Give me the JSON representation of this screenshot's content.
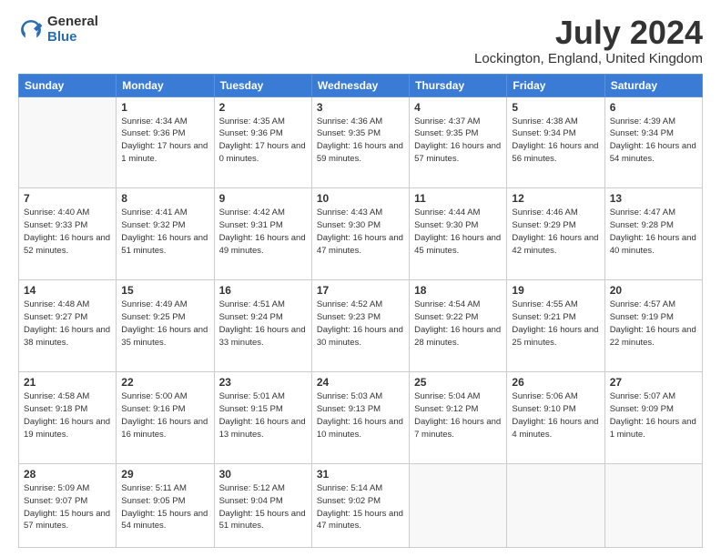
{
  "logo": {
    "general": "General",
    "blue": "Blue"
  },
  "title": "July 2024",
  "subtitle": "Lockington, England, United Kingdom",
  "days_of_week": [
    "Sunday",
    "Monday",
    "Tuesday",
    "Wednesday",
    "Thursday",
    "Friday",
    "Saturday"
  ],
  "weeks": [
    [
      {
        "day": "",
        "info": ""
      },
      {
        "day": "1",
        "info": "Sunrise: 4:34 AM\nSunset: 9:36 PM\nDaylight: 17 hours\nand 1 minute."
      },
      {
        "day": "2",
        "info": "Sunrise: 4:35 AM\nSunset: 9:36 PM\nDaylight: 17 hours\nand 0 minutes."
      },
      {
        "day": "3",
        "info": "Sunrise: 4:36 AM\nSunset: 9:35 PM\nDaylight: 16 hours\nand 59 minutes."
      },
      {
        "day": "4",
        "info": "Sunrise: 4:37 AM\nSunset: 9:35 PM\nDaylight: 16 hours\nand 57 minutes."
      },
      {
        "day": "5",
        "info": "Sunrise: 4:38 AM\nSunset: 9:34 PM\nDaylight: 16 hours\nand 56 minutes."
      },
      {
        "day": "6",
        "info": "Sunrise: 4:39 AM\nSunset: 9:34 PM\nDaylight: 16 hours\nand 54 minutes."
      }
    ],
    [
      {
        "day": "7",
        "info": "Sunrise: 4:40 AM\nSunset: 9:33 PM\nDaylight: 16 hours\nand 52 minutes."
      },
      {
        "day": "8",
        "info": "Sunrise: 4:41 AM\nSunset: 9:32 PM\nDaylight: 16 hours\nand 51 minutes."
      },
      {
        "day": "9",
        "info": "Sunrise: 4:42 AM\nSunset: 9:31 PM\nDaylight: 16 hours\nand 49 minutes."
      },
      {
        "day": "10",
        "info": "Sunrise: 4:43 AM\nSunset: 9:30 PM\nDaylight: 16 hours\nand 47 minutes."
      },
      {
        "day": "11",
        "info": "Sunrise: 4:44 AM\nSunset: 9:30 PM\nDaylight: 16 hours\nand 45 minutes."
      },
      {
        "day": "12",
        "info": "Sunrise: 4:46 AM\nSunset: 9:29 PM\nDaylight: 16 hours\nand 42 minutes."
      },
      {
        "day": "13",
        "info": "Sunrise: 4:47 AM\nSunset: 9:28 PM\nDaylight: 16 hours\nand 40 minutes."
      }
    ],
    [
      {
        "day": "14",
        "info": "Sunrise: 4:48 AM\nSunset: 9:27 PM\nDaylight: 16 hours\nand 38 minutes."
      },
      {
        "day": "15",
        "info": "Sunrise: 4:49 AM\nSunset: 9:25 PM\nDaylight: 16 hours\nand 35 minutes."
      },
      {
        "day": "16",
        "info": "Sunrise: 4:51 AM\nSunset: 9:24 PM\nDaylight: 16 hours\nand 33 minutes."
      },
      {
        "day": "17",
        "info": "Sunrise: 4:52 AM\nSunset: 9:23 PM\nDaylight: 16 hours\nand 30 minutes."
      },
      {
        "day": "18",
        "info": "Sunrise: 4:54 AM\nSunset: 9:22 PM\nDaylight: 16 hours\nand 28 minutes."
      },
      {
        "day": "19",
        "info": "Sunrise: 4:55 AM\nSunset: 9:21 PM\nDaylight: 16 hours\nand 25 minutes."
      },
      {
        "day": "20",
        "info": "Sunrise: 4:57 AM\nSunset: 9:19 PM\nDaylight: 16 hours\nand 22 minutes."
      }
    ],
    [
      {
        "day": "21",
        "info": "Sunrise: 4:58 AM\nSunset: 9:18 PM\nDaylight: 16 hours\nand 19 minutes."
      },
      {
        "day": "22",
        "info": "Sunrise: 5:00 AM\nSunset: 9:16 PM\nDaylight: 16 hours\nand 16 minutes."
      },
      {
        "day": "23",
        "info": "Sunrise: 5:01 AM\nSunset: 9:15 PM\nDaylight: 16 hours\nand 13 minutes."
      },
      {
        "day": "24",
        "info": "Sunrise: 5:03 AM\nSunset: 9:13 PM\nDaylight: 16 hours\nand 10 minutes."
      },
      {
        "day": "25",
        "info": "Sunrise: 5:04 AM\nSunset: 9:12 PM\nDaylight: 16 hours\nand 7 minutes."
      },
      {
        "day": "26",
        "info": "Sunrise: 5:06 AM\nSunset: 9:10 PM\nDaylight: 16 hours\nand 4 minutes."
      },
      {
        "day": "27",
        "info": "Sunrise: 5:07 AM\nSunset: 9:09 PM\nDaylight: 16 hours\nand 1 minute."
      }
    ],
    [
      {
        "day": "28",
        "info": "Sunrise: 5:09 AM\nSunset: 9:07 PM\nDaylight: 15 hours\nand 57 minutes."
      },
      {
        "day": "29",
        "info": "Sunrise: 5:11 AM\nSunset: 9:05 PM\nDaylight: 15 hours\nand 54 minutes."
      },
      {
        "day": "30",
        "info": "Sunrise: 5:12 AM\nSunset: 9:04 PM\nDaylight: 15 hours\nand 51 minutes."
      },
      {
        "day": "31",
        "info": "Sunrise: 5:14 AM\nSunset: 9:02 PM\nDaylight: 15 hours\nand 47 minutes."
      },
      {
        "day": "",
        "info": ""
      },
      {
        "day": "",
        "info": ""
      },
      {
        "day": "",
        "info": ""
      }
    ]
  ]
}
